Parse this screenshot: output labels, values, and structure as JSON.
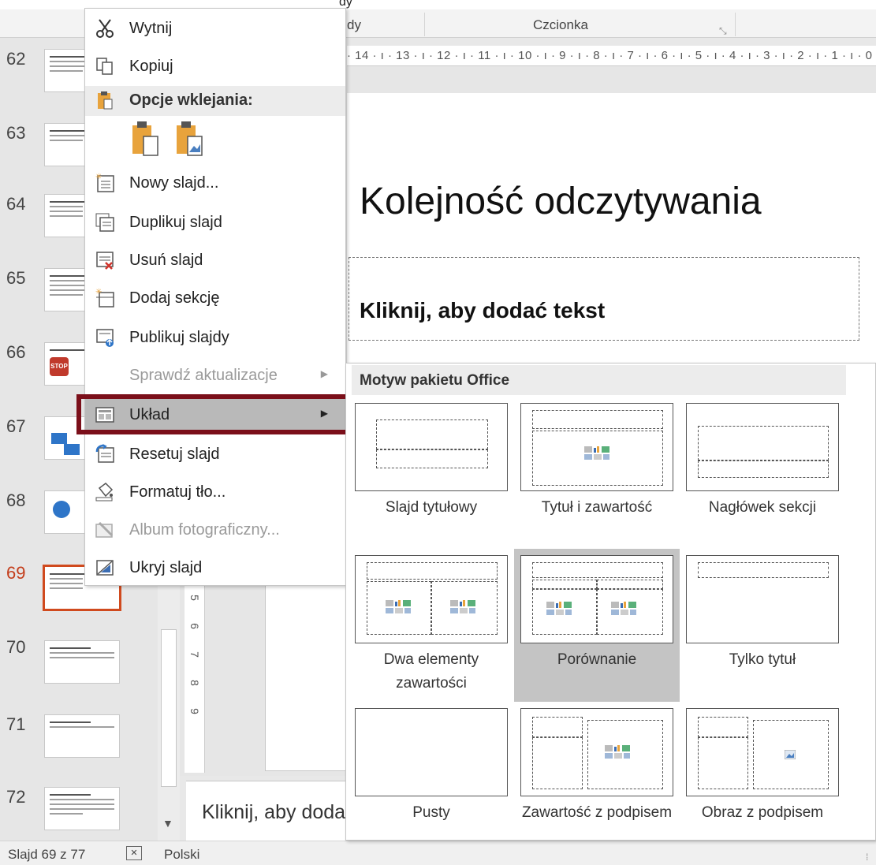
{
  "top_partial_text": [
    "dy",
    "„"
  ],
  "ribbon": {
    "groups": [
      {
        "label": "dy"
      },
      {
        "label": "Czcionka"
      }
    ]
  },
  "ruler_text": "· 14 · ı · 13 · ı · 12 · ı · 11 · ı · 10 · ı · 9 · ı · 8 · ı · 7 · ı · 6 · ı · 5 · ı · 4 · ı · 3 · ı · 2 · ı · 1 · ı · 0",
  "vruler_marks": [
    "5",
    "6",
    "7",
    "8",
    "9"
  ],
  "thumbnails": [
    {
      "num": "62"
    },
    {
      "num": "63"
    },
    {
      "num": "64"
    },
    {
      "num": "65"
    },
    {
      "num": "66"
    },
    {
      "num": "67"
    },
    {
      "num": "68"
    },
    {
      "num": "69",
      "active": true
    },
    {
      "num": "70"
    },
    {
      "num": "71"
    },
    {
      "num": "72"
    }
  ],
  "thumb_stop_text": "STOP",
  "slide": {
    "title": "Kolejność odczytywania",
    "placeholder": "Kliknij, aby dodać tekst",
    "notes": "Kliknij, aby dodać notatki"
  },
  "status": {
    "slide_counter": "Slajd 69 z 77",
    "language": "Polski"
  },
  "context_menu": {
    "items": [
      {
        "label": "Wytnij",
        "icon": "scissors-icon",
        "enabled": true
      },
      {
        "label": "Kopiuj",
        "icon": "copy-icon",
        "enabled": true
      },
      {
        "label": "Nowy slajd...",
        "icon": "new-slide-icon",
        "enabled": true
      },
      {
        "label": "Duplikuj slajd",
        "icon": "duplicate-slide-icon",
        "enabled": true
      },
      {
        "label": "Usuń slajd",
        "icon": "delete-slide-icon",
        "enabled": true
      },
      {
        "label": "Dodaj sekcję",
        "icon": "add-section-icon",
        "enabled": true
      },
      {
        "label": "Publikuj slajdy",
        "icon": "publish-slides-icon",
        "enabled": true
      },
      {
        "label": "Sprawdź aktualizacje",
        "icon": "",
        "enabled": false,
        "submenu": true
      },
      {
        "label": "Układ",
        "icon": "layout-icon",
        "enabled": true,
        "submenu": true,
        "highlighted": true
      },
      {
        "label": "Resetuj slajd",
        "icon": "reset-slide-icon",
        "enabled": true
      },
      {
        "label": "Formatuj tło...",
        "icon": "format-background-icon",
        "enabled": true
      },
      {
        "label": "Album fotograficzny...",
        "icon": "photo-album-icon",
        "enabled": false
      },
      {
        "label": "Ukryj slajd",
        "icon": "hide-slide-icon",
        "enabled": true
      }
    ],
    "paste_header": "Opcje wklejania:",
    "paste_options": [
      "paste-keep-source-icon",
      "paste-picture-icon"
    ]
  },
  "layout_menu": {
    "header": "Motyw pakietu Office",
    "selected": "Porównanie",
    "layouts": [
      {
        "label": "Slajd tytułowy"
      },
      {
        "label": "Tytuł i zawartość"
      },
      {
        "label": "Nagłówek sekcji"
      },
      {
        "label": "Dwa elementy zawartości"
      },
      {
        "label": "Porównanie"
      },
      {
        "label": "Tylko tytuł"
      },
      {
        "label": "Pusty"
      },
      {
        "label": "Zawartość z podpisem"
      },
      {
        "label": "Obraz z podpisem"
      }
    ]
  },
  "colors": {
    "accent": "#d04a1e",
    "highlight_frame": "#7b0f1a",
    "menu_hover": "#b9b9b9"
  }
}
